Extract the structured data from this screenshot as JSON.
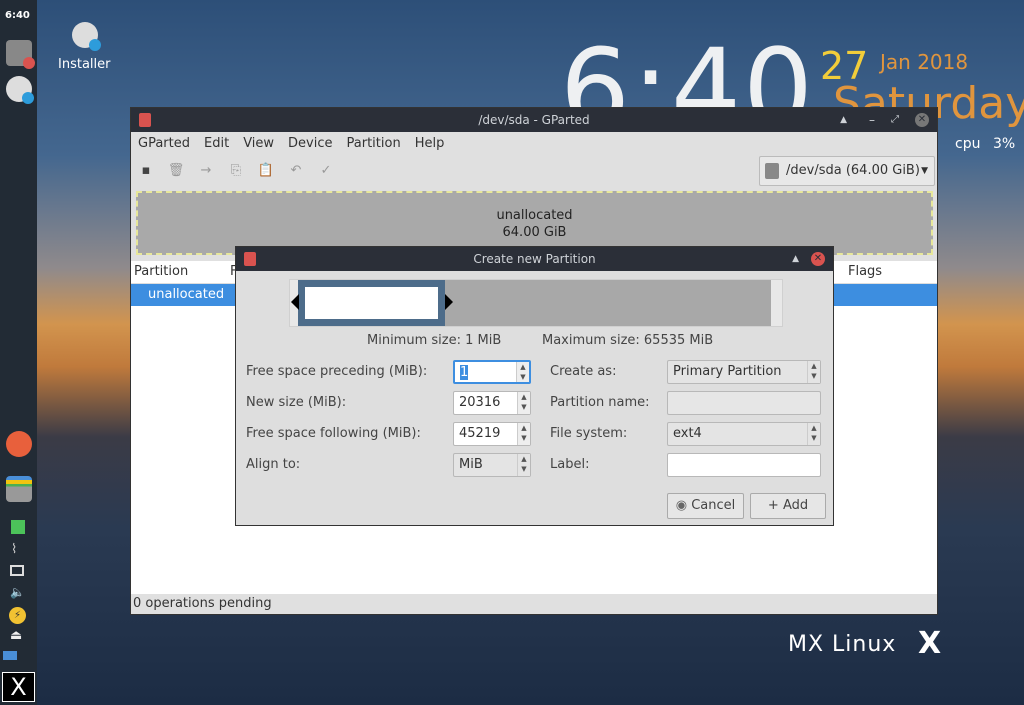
{
  "panel": {
    "clock": "6:40"
  },
  "desktop": {
    "installer_label": "Installer",
    "big_clock": "6:40",
    "day": "27",
    "month_year": "Jan 2018",
    "weekday": "Saturday",
    "cpu_label": "cpu",
    "cpu_value": "3%",
    "logo": "MX Linux"
  },
  "gparted": {
    "title": "/dev/sda - GParted",
    "menu": [
      "GParted",
      "Edit",
      "View",
      "Device",
      "Partition",
      "Help"
    ],
    "device_selector": "/dev/sda  (64.00 GiB)",
    "disk_graphic": {
      "name": "unallocated",
      "size": "64.00 GiB"
    },
    "columns": [
      "Partition",
      "F",
      "Flags"
    ],
    "rows": [
      {
        "partition": "unallocated"
      }
    ],
    "status": "0 operations pending"
  },
  "dialog": {
    "title": "Create new Partition",
    "min_size": "Minimum size: 1 MiB",
    "max_size": "Maximum size: 65535 MiB",
    "new_partition_fraction": 0.31,
    "fields": {
      "preceding_label": "Free space preceding (MiB):",
      "preceding": "1",
      "size_label": "New size (MiB):",
      "size": "20316",
      "following_label": "Free space following (MiB):",
      "following": "45219",
      "align_label": "Align to:",
      "align": "MiB",
      "create_as_label": "Create as:",
      "create_as": "Primary Partition",
      "name_label": "Partition name:",
      "name": "",
      "fs_label": "File system:",
      "fs": "ext4",
      "label_label": "Label:",
      "label": ""
    },
    "cancel": "Cancel",
    "add": "Add",
    "cancel_icon": "circle-icon",
    "add_icon": "+"
  },
  "colors": {
    "selection": "#3d8ee0",
    "titlebar": "#2b2f38",
    "partition": "#4d6c8a"
  }
}
